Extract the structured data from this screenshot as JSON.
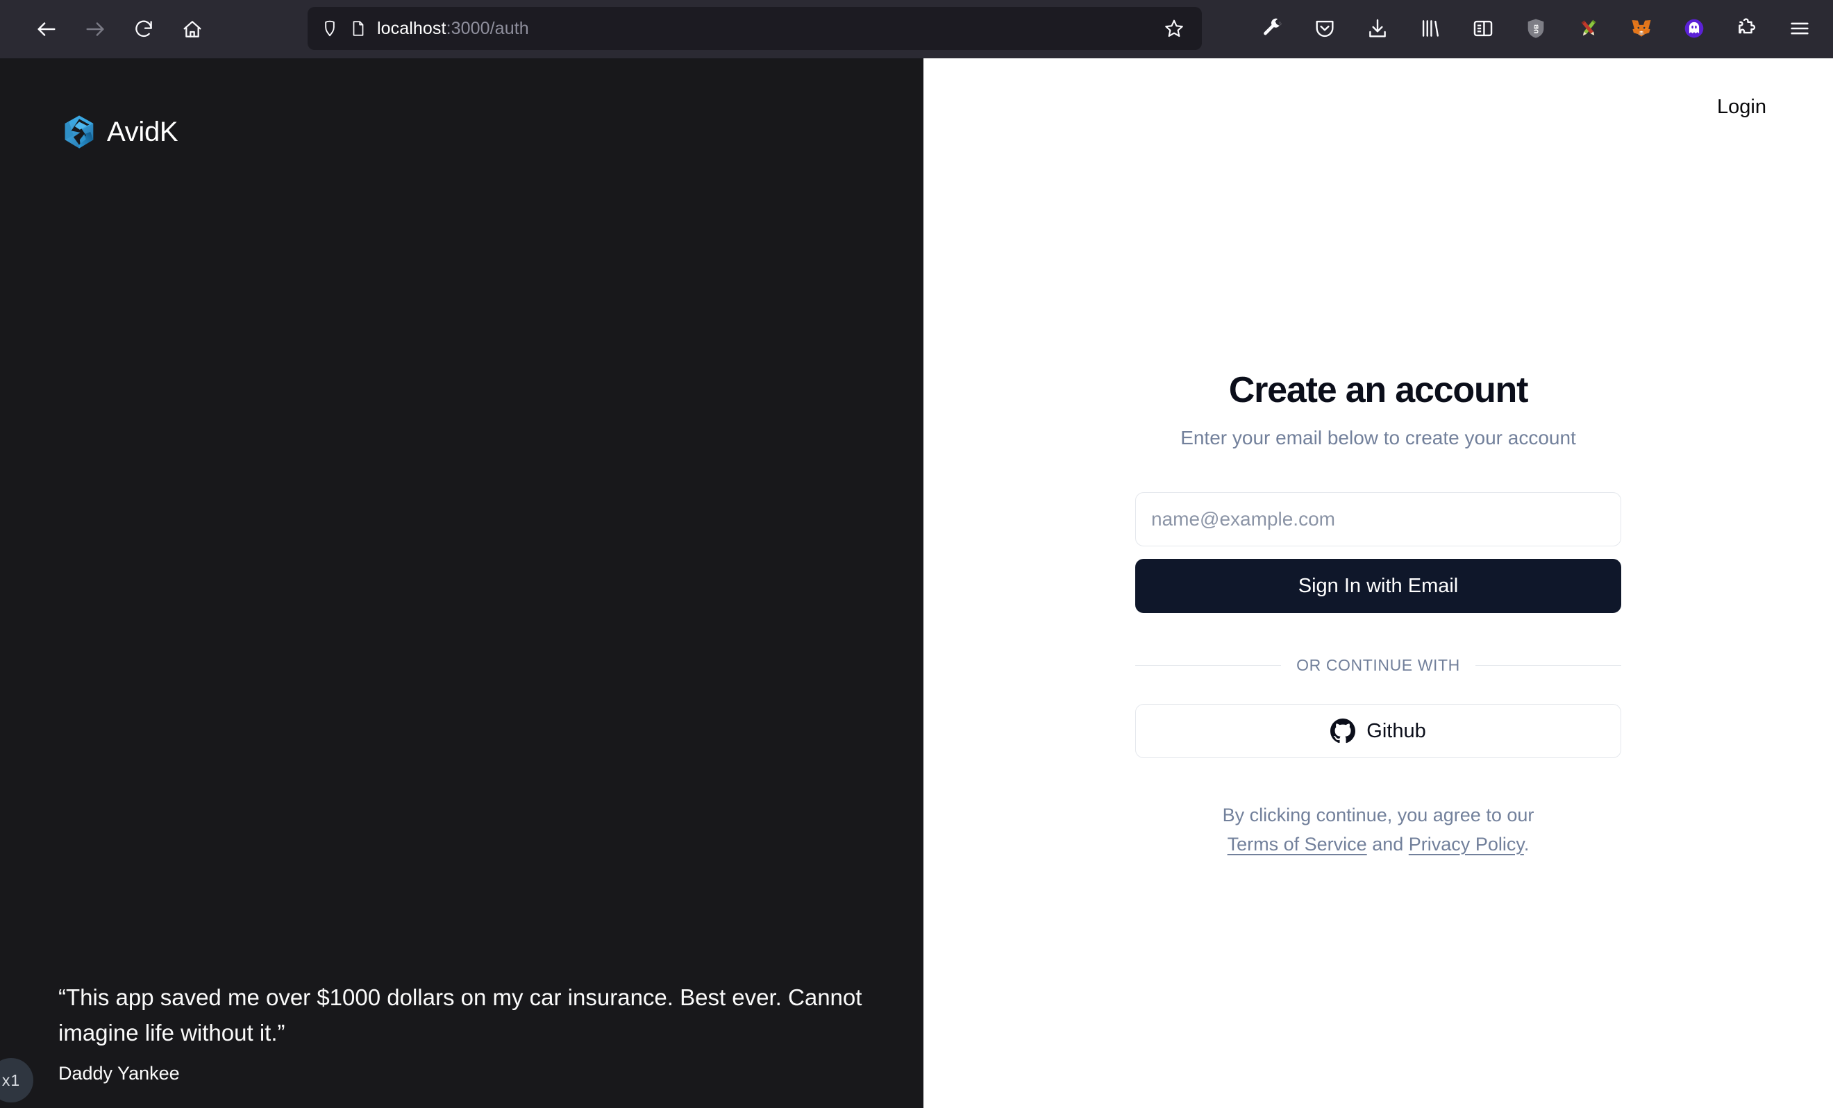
{
  "browser": {
    "nav": {
      "back": "back-arrow",
      "forward": "forward-arrow",
      "reload": "reload",
      "home": "home"
    },
    "url": {
      "host": "localhost",
      "path": ":3000/auth",
      "shield_icon": "shield-icon",
      "page_icon": "page-icon",
      "bookmark_icon": "star-icon"
    },
    "toolbar_icons": [
      "wrench-icon",
      "pocket-icon",
      "downloads-icon",
      "library-icon",
      "sidebar-icon",
      "ublock-origin-icon",
      "pencils-extension-icon",
      "metamask-icon",
      "ghost-extension-icon",
      "extensions-puzzle-icon",
      "app-menu-icon"
    ]
  },
  "promo": {
    "brand_name": "AvidK",
    "logo_icon": "avidk-logo-icon",
    "quote": "“This app saved me over $1000 dollars on my car insurance. Best ever. Cannot imagine life without it.”",
    "author": "Daddy Yankee",
    "zoom_badge": "x1"
  },
  "auth": {
    "login_label": "Login",
    "title": "Create an account",
    "subtitle": "Enter your email below to create your account",
    "email_placeholder": "name@example.com",
    "email_value": "",
    "submit_label": "Sign In with Email",
    "divider_label": "OR CONTINUE WITH",
    "github_label": "Github",
    "github_icon": "github-icon",
    "legal_prefix": "By clicking continue, you agree to our",
    "legal_terms": "Terms of Service",
    "legal_and": "and",
    "legal_privacy": "Privacy Policy",
    "legal_period": "."
  },
  "colors": {
    "chrome_bg": "#2b2a33",
    "urlbar_bg": "#1c1b22",
    "promo_bg": "#18181b",
    "accent_dark": "#0f172a",
    "muted_text": "#72809b",
    "border": "#e4e7ec",
    "brand_blue": "#2b96d8"
  }
}
